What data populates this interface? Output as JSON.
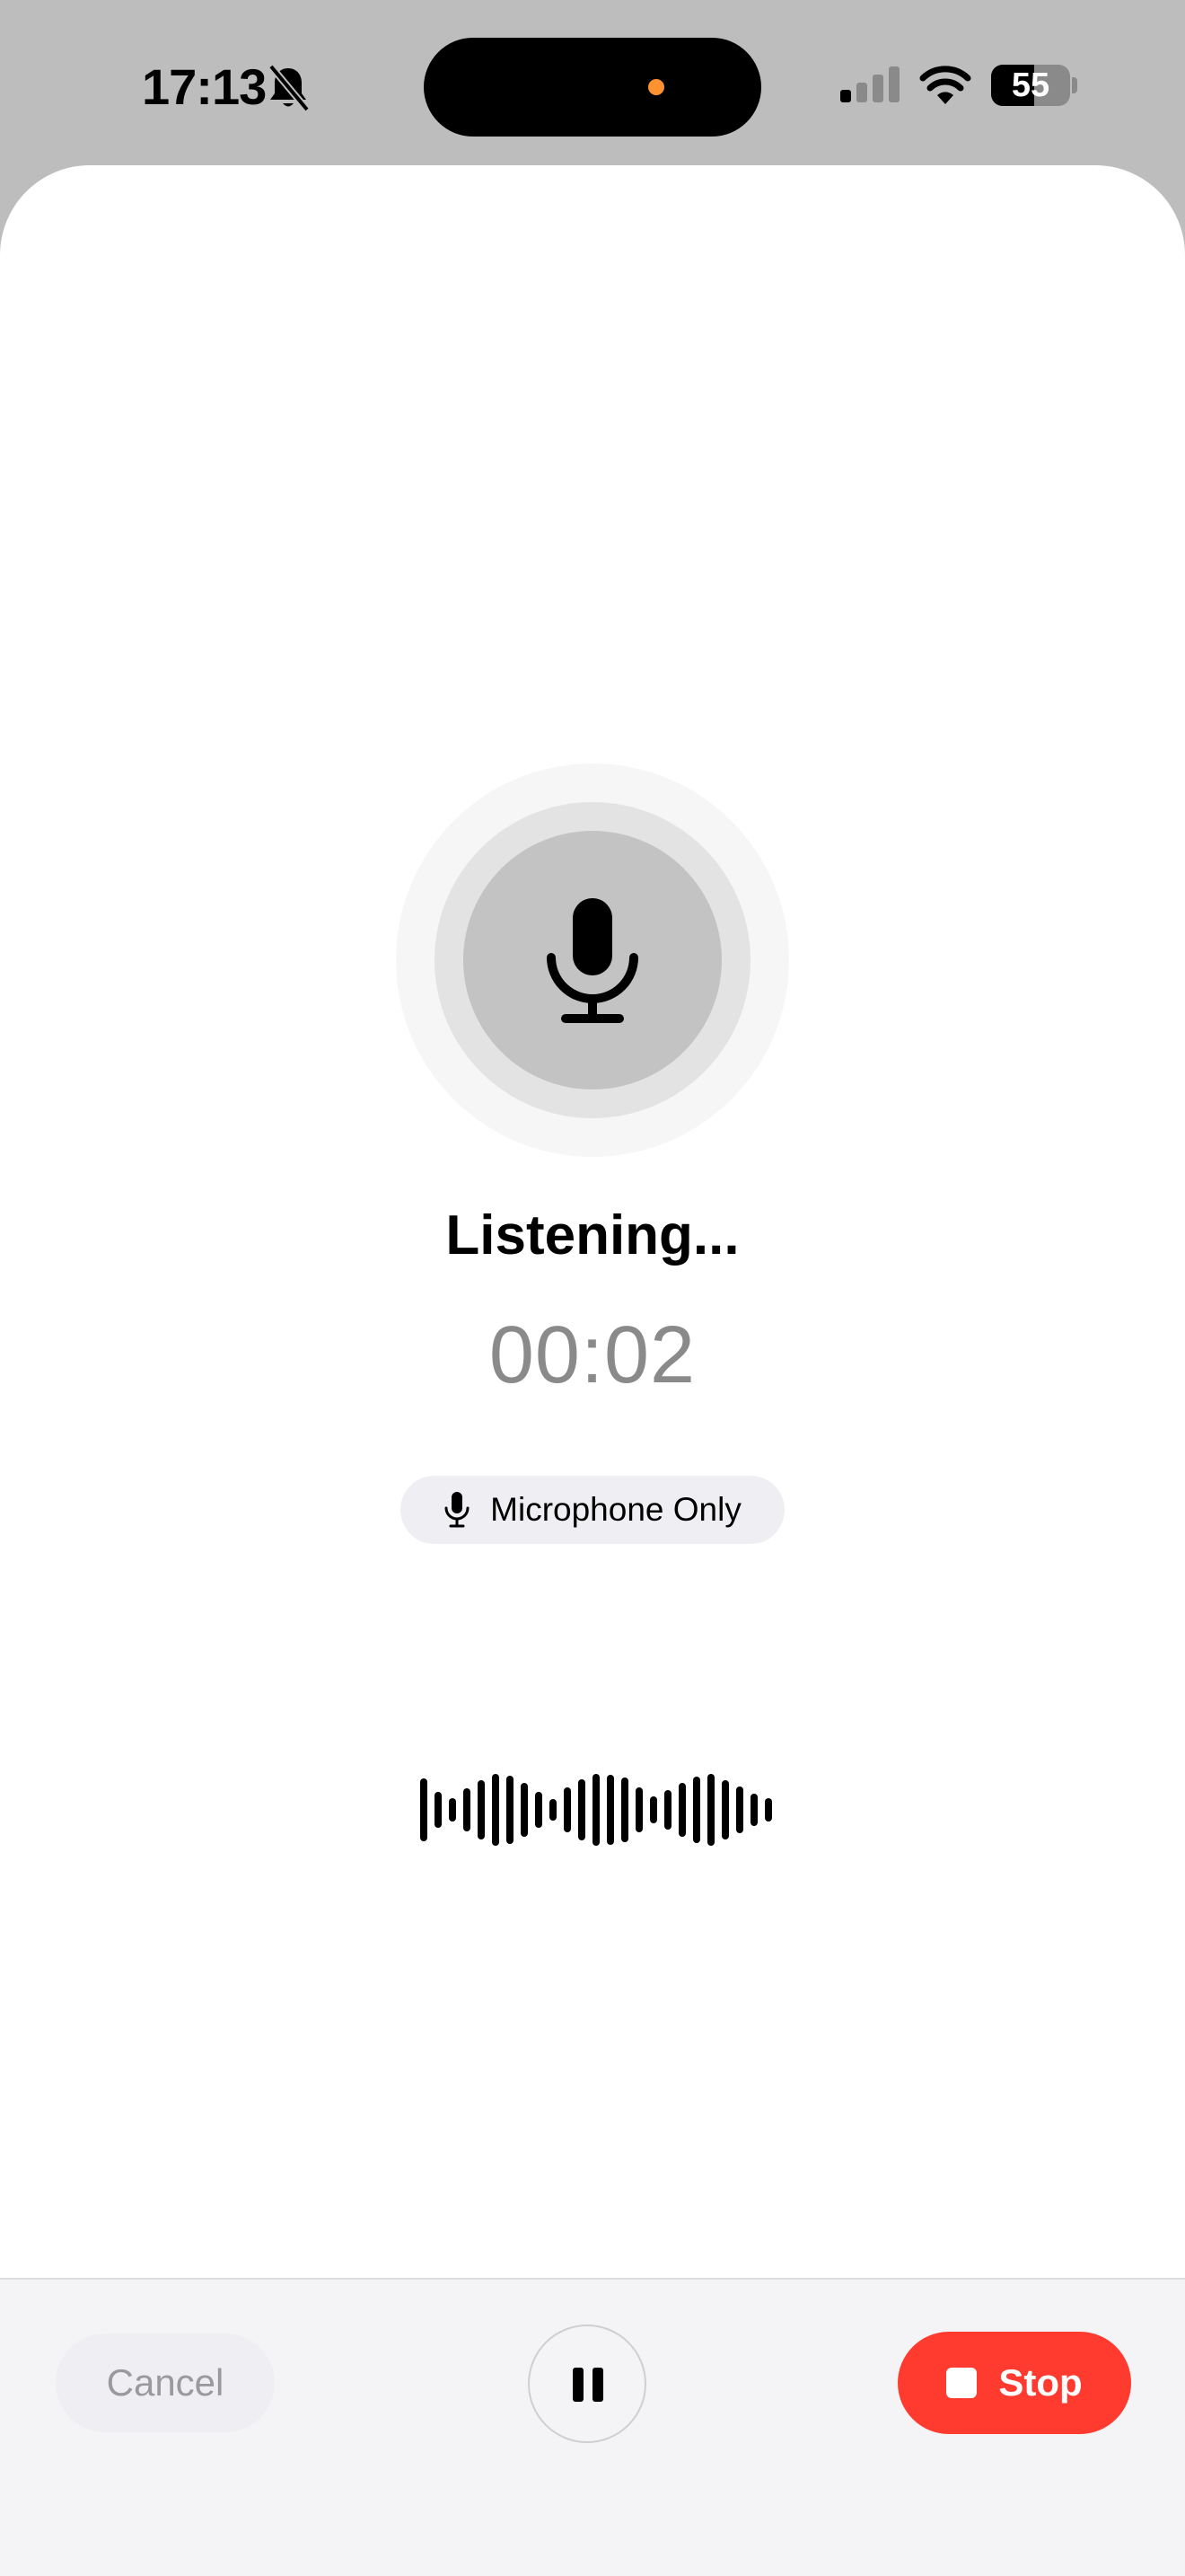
{
  "status_bar": {
    "time": "17:13",
    "battery_level": "55",
    "battery_fraction": 0.55,
    "icons": [
      "bell-slash-icon",
      "cellular-signal-icon",
      "wifi-icon",
      "battery-icon"
    ],
    "island_dot_color": "#ff9230"
  },
  "recorder": {
    "status": "Listening...",
    "elapsed": "00:02",
    "source_label": "Microphone Only",
    "mic_icon": "microphone-icon"
  },
  "controls": {
    "cancel_label": "Cancel",
    "pause_icon": "pause-icon",
    "stop_label": "Stop",
    "stop_color": "#ff3b30"
  }
}
